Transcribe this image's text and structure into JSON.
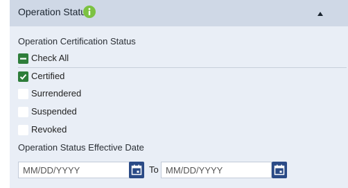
{
  "panel": {
    "title": "Operation Status",
    "info_icon": "info-icon",
    "collapse_icon": "caret-up-icon"
  },
  "certification": {
    "label": "Operation Certification Status",
    "check_all": {
      "label": "Check All",
      "state": "indeterminate"
    },
    "options": [
      {
        "label": "Certified",
        "checked": true
      },
      {
        "label": "Surrendered",
        "checked": false
      },
      {
        "label": "Suspended",
        "checked": false
      },
      {
        "label": "Revoked",
        "checked": false
      }
    ]
  },
  "effective_date": {
    "label": "Operation Status Effective Date",
    "from_placeholder": "MM/DD/YYYY",
    "to_label": "To",
    "to_placeholder": "MM/DD/YYYY",
    "calendar_icon": "calendar-icon"
  },
  "colors": {
    "header_bg": "#cfd8e6",
    "panel_bg": "#e9eef6",
    "check_green": "#2e7d3a",
    "info_green": "#7cc242",
    "calendar_blue": "#2a4a86"
  }
}
